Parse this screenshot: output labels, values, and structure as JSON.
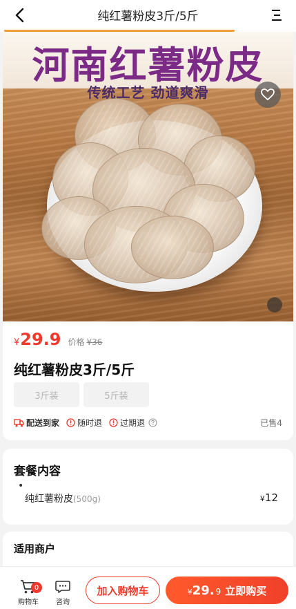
{
  "header": {
    "title": "纯红薯粉皮3斤/5斤",
    "back_icon": "chevron-left-icon",
    "menu_icon": "menu-icon"
  },
  "image": {
    "title": "河南红薯粉皮",
    "subtitle": "传统工艺 劲道爽滑",
    "favorite_icon": "heart-icon"
  },
  "product": {
    "price_symbol": "¥",
    "price": "29.9",
    "orig_label": "价格",
    "orig_price": "¥36",
    "name": "纯红薯粉皮3斤/5斤",
    "specs": [
      "3斤装",
      "5斤装"
    ],
    "services": {
      "delivery": "配送到家",
      "refund_anytime": "随时退",
      "refund_expired": "过期退"
    },
    "sold": "已售4"
  },
  "package": {
    "title": "套餐内容",
    "bullet": "•",
    "item_name": "纯红薯粉皮",
    "item_weight": "(500g)",
    "item_price_symbol": "¥",
    "item_price": "12"
  },
  "merchant": {
    "title": "适用商户"
  },
  "bottom": {
    "cart_label": "购物车",
    "cart_count": "0",
    "consult_label": "咨询",
    "add_cart": "加入购物车",
    "buy_symbol": "¥",
    "buy_price": "29.",
    "buy_decimal": "9",
    "buy_label": "立即购买"
  },
  "colors": {
    "accent": "#ee3a2c",
    "underline": "#f39c35",
    "image_title": "#7b2b86"
  }
}
